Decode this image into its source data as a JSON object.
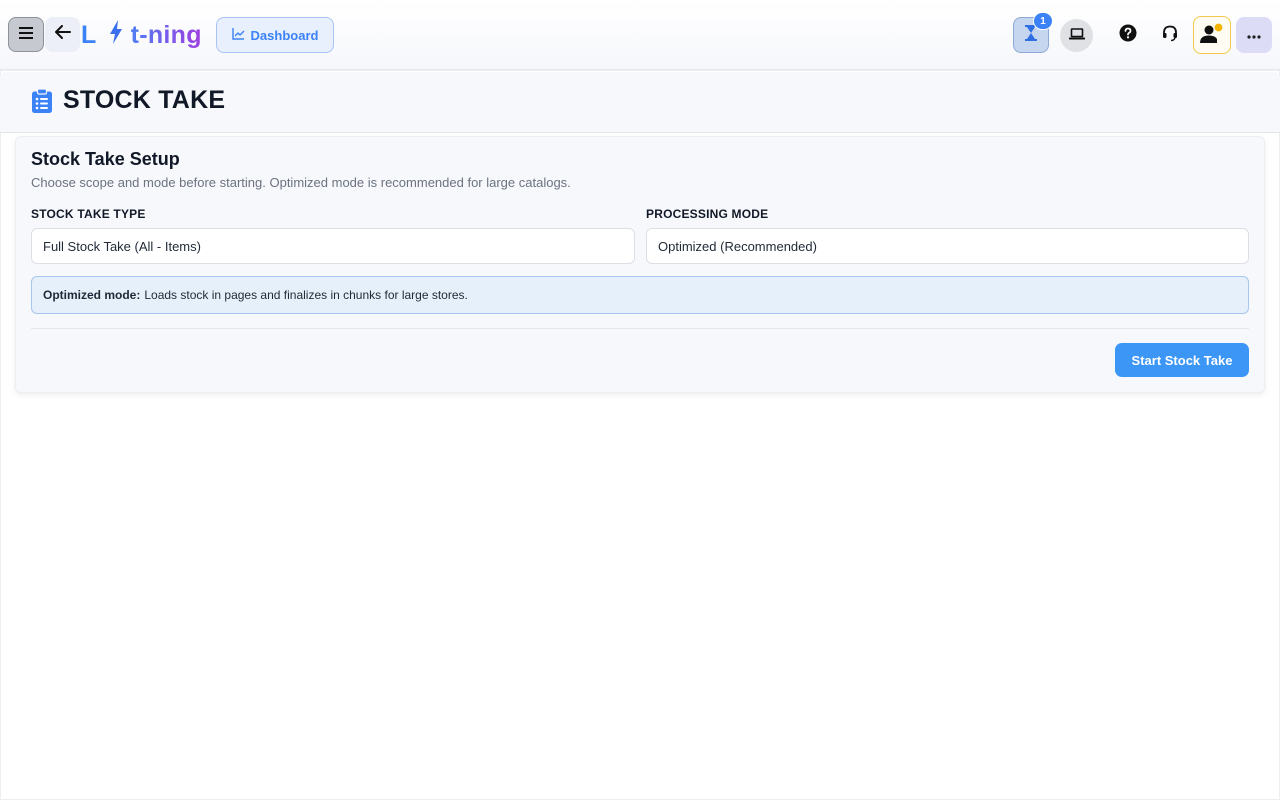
{
  "header": {
    "logo_left": "L",
    "logo_right": "t-ning",
    "dashboard_label": "Dashboard",
    "notification_count": "1"
  },
  "page": {
    "title": "STOCK TAKE"
  },
  "setup": {
    "title": "Stock Take Setup",
    "subtitle": "Choose scope and mode before starting. Optimized mode is recommended for large catalogs.",
    "type_label": "STOCK TAKE TYPE",
    "type_value": "Full Stock Take (All - Items)",
    "mode_label": "PROCESSING MODE",
    "mode_value": "Optimized (Recommended)",
    "info_strong": "Optimized mode:",
    "info_text": "Loads stock in pages and finalizes in chunks for large stores.",
    "start_label": "Start Stock Take"
  },
  "icons": {
    "menu": "hamburger-icon",
    "back": "arrow-left-icon",
    "logo_bolt": "lightning-bolt-icon",
    "dashboard": "line-chart-icon",
    "pending": "hourglass-icon",
    "device": "laptop-icon",
    "help": "question-circle-icon",
    "support": "headset-icon",
    "user": "user-status-icon",
    "more": "more-dots-icon",
    "page": "clipboard-list-icon"
  },
  "colors": {
    "accent": "#3b82f6",
    "button": "#3b96f5",
    "info_bg": "#e6f0fb",
    "logo_gradient_end": "#9f3fe0",
    "user_status": "#f5b400"
  }
}
